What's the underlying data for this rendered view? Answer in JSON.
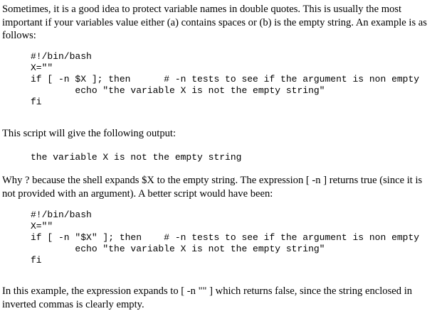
{
  "paragraphs": [
    "Sometimes, it is a good idea to protect variable names in double quotes. This is usually the most important if your variables value either (a) contains spaces or (b) is the empty string. An example is as follows:",
    "This script will give the following output:",
    "Why ? because the shell expands $X to the empty string. The expression [ -n ] returns true (since it is not provided with an argument). A better script would have been:",
    "In this example, the expression expands to [ -n \"\" ] which returns false, since the string enclosed in inverted commas is clearly empty."
  ],
  "code_blocks": [
    "#!/bin/bash\nX=\"\"\nif [ -n $X ]; then      # -n tests to see if the argument is non empty\n        echo \"the variable X is not the empty string\"\nfi",
    "the variable X is not the empty string",
    "#!/bin/bash\nX=\"\"\nif [ -n \"$X\" ]; then    # -n tests to see if the argument is non empty\n        echo \"the variable X is not the empty string\"\nfi"
  ]
}
